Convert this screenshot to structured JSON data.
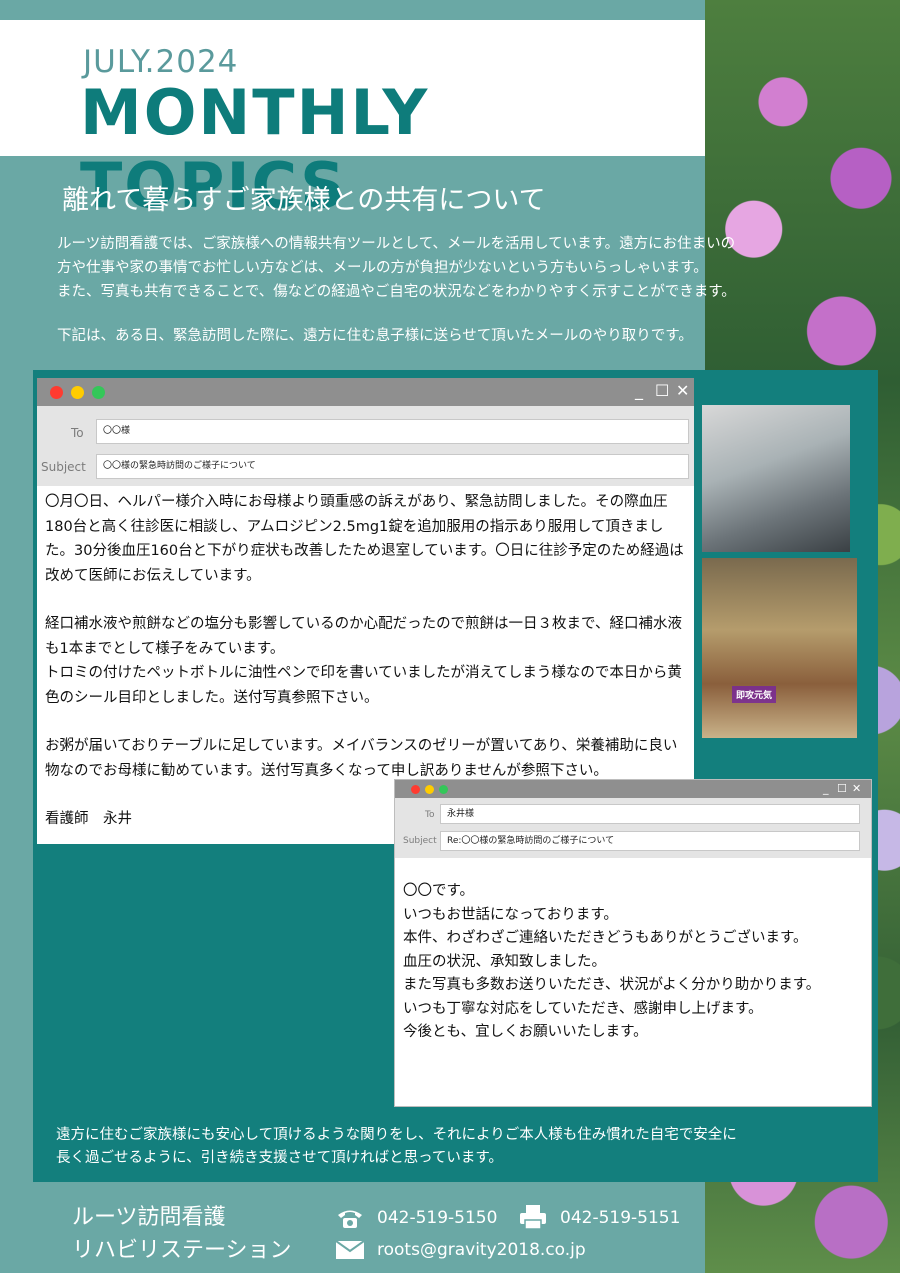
{
  "header": {
    "month": "JULY.2024",
    "title": "MONTHLY TOPICS"
  },
  "section": {
    "title": "離れて暮らすご家族様との共有について",
    "intro_lines": [
      "ルーツ訪問看護では、ご家族様への情報共有ツールとして、メールを活用しています。遠方にお住まいの",
      "方や仕事や家の事情でお忙しい方などは、メールの方が負担が少ないという方もいらっしゃいます。",
      "また、写真も共有できることで、傷などの経過やご自宅の状況などをわかりやすく示すことができます。"
    ],
    "intro_note": "下記は、ある日、緊急訪問した際に、遠方に住む息子様に送らせて頂いたメールのやり取りです。"
  },
  "mail1": {
    "to_label": "To",
    "to_value": "〇〇様",
    "subject_label": "Subject",
    "subject_value": "〇〇様の緊急時訪問のご様子について",
    "window_buttons": [
      "_",
      "☐",
      "✕"
    ],
    "paragraphs": [
      "〇月〇日、ヘルパー様介入時にお母様より頭重感の訴えがあり、緊急訪問しました。その際血圧180台と高く往診医に相談し、アムロジピン2.5mg1錠を追加服用の指示あり服用して頂きました。30分後血圧160台と下がり症状も改善したため退室しています。〇日に往診予定のため経過は改めて医師にお伝えしています。",
      "経口補水液や煎餅などの塩分も影響しているのか心配だったので煎餅は一日３枚まで、経口補水液も1本までとして様子をみています。\nトロミの付けたペットボトルに油性ペンで印を書いていましたが消えてしまう様なので本日から黄色のシール目印としました。送付写真参照下さい。",
      "お粥が届いておりテーブルに足しています。メイバランスのゼリーが置いてあり、栄養補助に良い物なのでお母様に勧めています。送付写真多くなって申し訳ありませんが参照下さい。",
      "看護師　永井"
    ]
  },
  "photos": {
    "label": "即攻元気"
  },
  "mail2": {
    "to_label": "To",
    "to_value": "永井様",
    "subject_label": "Subject",
    "subject_value": "Re:〇〇様の緊急時訪問のご様子について",
    "window_buttons": [
      "_",
      "☐",
      "✕"
    ],
    "lines": [
      "〇〇です。",
      "いつもお世話になっております。",
      "本件、わざわざご連絡いただきどうもありがとうございます。",
      "血圧の状況、承知致しました。",
      "また写真も多数お送りいただき、状況がよく分かり助かります。",
      "いつも丁寧な対応をしていただき、感謝申し上げます。",
      "今後とも、宜しくお願いいたします。"
    ]
  },
  "closing": {
    "lines": [
      "遠方に住むご家族様にも安心して頂けるような関りをし、それによりご本人様も住み慣れた自宅で安全に",
      "長く過ごせるように、引き続き支援させて頂ければと思っています。"
    ]
  },
  "footer": {
    "org_line1": "ルーツ訪問看護",
    "org_line2": "リハビリステーション",
    "phone": "042-519-5150",
    "fax": "042-519-5151",
    "email": "roots@gravity2018.co.jp",
    "icons": [
      "phone-icon",
      "fax-icon",
      "mail-icon"
    ]
  },
  "colors": {
    "teal_title": "#0e7c7b",
    "teal_bg": "#6aa8a5",
    "panel": "#137f7d",
    "dot_red": "#ff3b30",
    "dot_yellow": "#ffcc00",
    "dot_green": "#34c759"
  }
}
